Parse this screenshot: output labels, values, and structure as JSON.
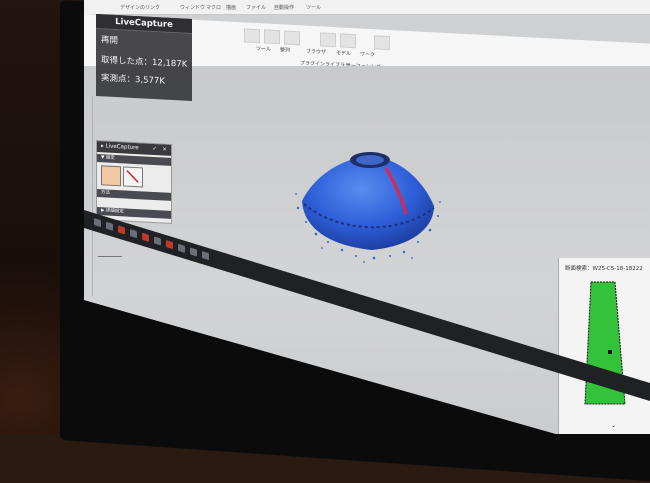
{
  "app": {
    "ribbon_tabs": [
      "デザインのリンク",
      "ウィンドウ",
      "マクロ",
      "描画",
      "ファイル",
      "自動操作",
      "ツール"
    ],
    "ribbon_groups": [
      "ツール",
      "整列",
      "ブラウザ",
      "モデル",
      "ワーク",
      "プラグインライブラリ",
      "サーフェシング"
    ]
  },
  "live_capture": {
    "title": "LiveCapture",
    "state_label": "再開",
    "acquired_points": "取得した点：12,187K",
    "measured_points": "実測点：3,577K"
  },
  "dock": {
    "title": "LiveCapture",
    "section_1": "▼ 設定",
    "section_2": "方法",
    "section_3": "▶ 詳細設定"
  },
  "section_panel": {
    "title": "断面検索：W25-C5-18-18222",
    "chevron": "⌄"
  },
  "colors": {
    "scan_blue": "#2f5fd8",
    "scan_highlight": "#e0254a",
    "section_green": "#33c23a"
  },
  "icons": [
    "livecapture-pin-icon",
    "checkmark-icon",
    "close-icon",
    "capture-tool-icon",
    "chevron-down-icon",
    "taskbar-app-icon"
  ]
}
